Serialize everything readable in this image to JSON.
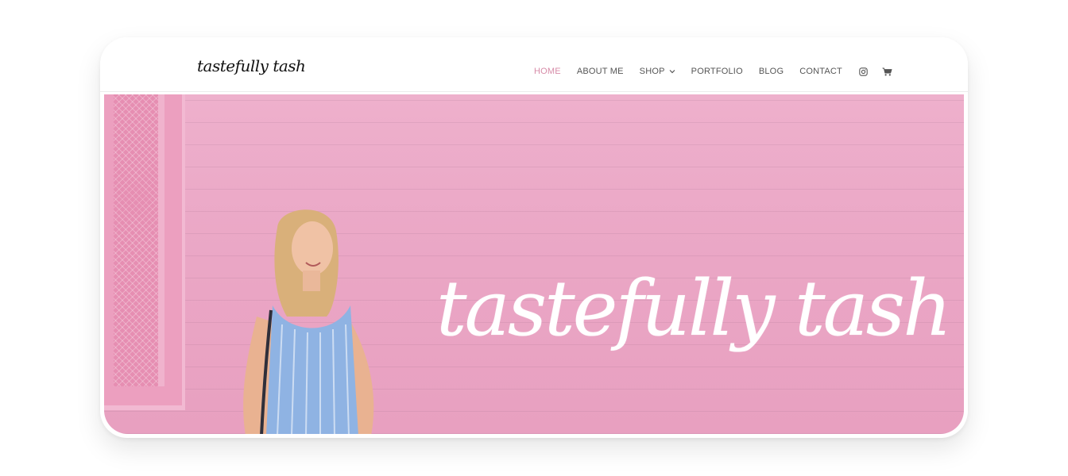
{
  "site": {
    "logo_text": "tastefully tash",
    "hero_title": "tastefully tash"
  },
  "nav": {
    "items": [
      {
        "label": "HOME",
        "active": true
      },
      {
        "label": "ABOUT ME",
        "active": false
      },
      {
        "label": "SHOP",
        "active": false,
        "has_dropdown": true
      },
      {
        "label": "PORTFOLIO",
        "active": false
      },
      {
        "label": "BLOG",
        "active": false
      },
      {
        "label": "CONTACT",
        "active": false
      }
    ],
    "icons": [
      "instagram-icon",
      "cart-icon"
    ]
  },
  "colors": {
    "accent": "#d78ca8",
    "nav_text": "#555555",
    "hero_pink": "#eaa6c5",
    "hero_text": "#ffffff"
  }
}
